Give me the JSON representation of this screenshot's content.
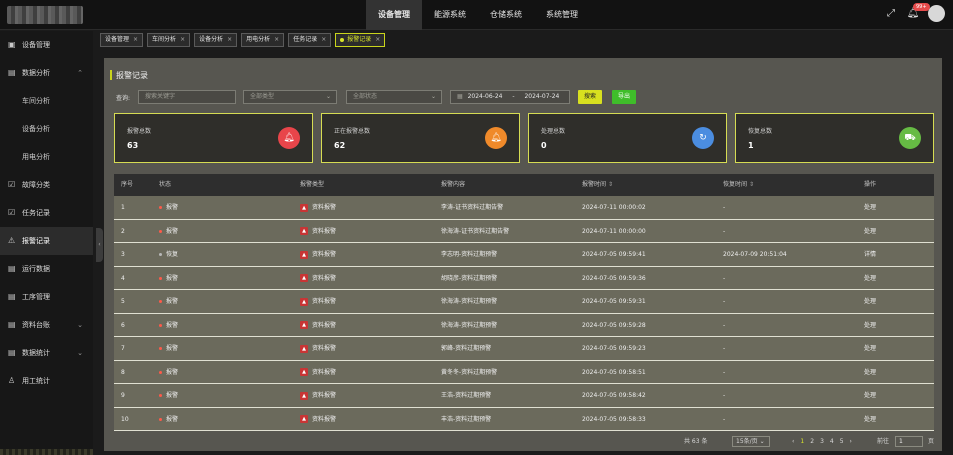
{
  "topnav": [
    "设备管理",
    "能源系统",
    "仓储系统",
    "系统管理"
  ],
  "notice_count": "99+",
  "sidebar": {
    "items": [
      {
        "label": "设备管理",
        "icon": "box-icon"
      },
      {
        "label": "数据分析",
        "icon": "doc-icon",
        "arrow": "^"
      },
      {
        "label": "车间分析",
        "sub": true
      },
      {
        "label": "设备分析",
        "sub": true
      },
      {
        "label": "用电分析",
        "sub": true
      },
      {
        "label": "故障分类",
        "icon": "check-icon"
      },
      {
        "label": "任务记录",
        "icon": "check-icon"
      },
      {
        "label": "报警记录",
        "icon": "warning-icon",
        "active": true
      },
      {
        "label": "运行数据",
        "icon": "doc-icon"
      },
      {
        "label": "工序管理",
        "icon": "doc-icon"
      },
      {
        "label": "资料台账",
        "icon": "doc-icon",
        "arrow": "v"
      },
      {
        "label": "数据统计",
        "icon": "doc-icon",
        "arrow": "v"
      },
      {
        "label": "用工统计",
        "icon": "person-icon"
      }
    ]
  },
  "tabs": [
    "设备管理",
    "车间分析",
    "设备分析",
    "用电分析",
    "任务记录",
    "报警记录"
  ],
  "panel_title": "报警记录",
  "filters": {
    "label": "查询:",
    "keyword_placeholder": "搜索关键字",
    "type_placeholder": "全部类型",
    "status_placeholder": "全部状态",
    "date_from": "2024-06-24",
    "date_sep": "-",
    "date_to": "2024-07-24",
    "search": "搜索",
    "export": "导出"
  },
  "stats": [
    {
      "title": "报警总数",
      "value": "63",
      "color": "#e8454a",
      "icon": "bell-icon"
    },
    {
      "title": "正在报警总数",
      "value": "62",
      "color": "#f08a2a",
      "icon": "bell-ring-icon"
    },
    {
      "title": "处理总数",
      "value": "0",
      "color": "#4b8de0",
      "icon": "refresh-icon"
    },
    {
      "title": "恢复总数",
      "value": "1",
      "color": "#66bb44",
      "icon": "truck-icon"
    }
  ],
  "table": {
    "headers": [
      "序号",
      "状态",
      "报警类型",
      "报警内容",
      "报警时间",
      "恢复时间",
      "操作"
    ],
    "rows": [
      {
        "no": "1",
        "status": "报警",
        "type": "资料报警",
        "content": "李涛-证书资料过期告警",
        "time": "2024-07-11 00:00:02",
        "recover": "-",
        "op": "处理"
      },
      {
        "no": "2",
        "status": "报警",
        "type": "资料报警",
        "content": "徐海涛-证书资料过期告警",
        "time": "2024-07-11 00:00:00",
        "recover": "-",
        "op": "处理"
      },
      {
        "no": "3",
        "status": "恢复",
        "type": "资料报警",
        "content": "李志明-资料过期预警",
        "time": "2024-07-05 09:59:41",
        "recover": "2024-07-09 20:51:04",
        "op": "详情"
      },
      {
        "no": "4",
        "status": "报警",
        "type": "资料报警",
        "content": "胡晓彦-资料过期预警",
        "time": "2024-07-05 09:59:36",
        "recover": "-",
        "op": "处理"
      },
      {
        "no": "5",
        "status": "报警",
        "type": "资料报警",
        "content": "徐海涛-资料过期预警",
        "time": "2024-07-05 09:59:31",
        "recover": "-",
        "op": "处理"
      },
      {
        "no": "6",
        "status": "报警",
        "type": "资料报警",
        "content": "徐海涛-资料过期预警",
        "time": "2024-07-05 09:59:28",
        "recover": "-",
        "op": "处理"
      },
      {
        "no": "7",
        "status": "报警",
        "type": "资料报警",
        "content": "郭峰-资料过期预警",
        "time": "2024-07-05 09:59:23",
        "recover": "-",
        "op": "处理"
      },
      {
        "no": "8",
        "status": "报警",
        "type": "资料报警",
        "content": "黄冬冬-资料过期预警",
        "time": "2024-07-05 09:58:51",
        "recover": "-",
        "op": "处理"
      },
      {
        "no": "9",
        "status": "报警",
        "type": "资料报警",
        "content": "王浩-资料过期预警",
        "time": "2024-07-05 09:58:42",
        "recover": "-",
        "op": "处理"
      },
      {
        "no": "10",
        "status": "报警",
        "type": "资料报警",
        "content": "丰浩-资料过期预警",
        "time": "2024-07-05 09:58:33",
        "recover": "-",
        "op": "处理"
      }
    ]
  },
  "pager": {
    "total": "共 63 条",
    "page_size": "15条/页",
    "prev": "‹",
    "pages": [
      "1",
      "2",
      "3",
      "4",
      "5"
    ],
    "next": "›",
    "goto_label": "前往",
    "goto_value": "1",
    "page_unit": "页"
  },
  "colors": {
    "accent": "#d7e22a",
    "danger": "#ff5a4a",
    "export": "#3fbd2a"
  }
}
